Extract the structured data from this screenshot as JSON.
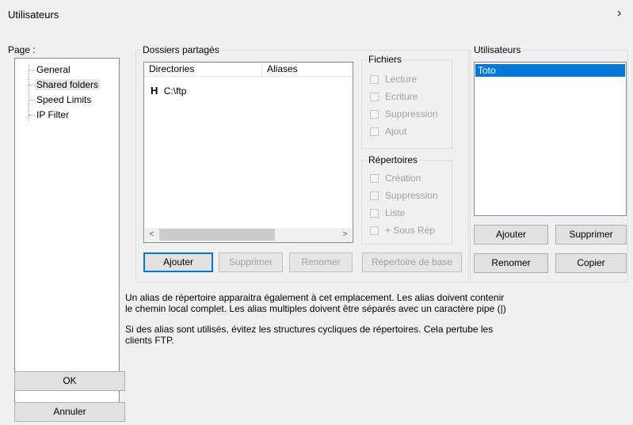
{
  "window": {
    "title": "Utilisateurs",
    "close_glyph": "›"
  },
  "page_panel": {
    "label": "Page :",
    "items": [
      "General",
      "Shared folders",
      "Speed Limits",
      "IP Filter"
    ]
  },
  "shared": {
    "group_title": "Dossiers partagés",
    "columns": [
      "Directories",
      "Aliases"
    ],
    "rows": [
      {
        "flag": "H",
        "directory": "C:\\ftp",
        "alias": ""
      }
    ],
    "scroll_left": "<",
    "scroll_right": ">",
    "buttons": {
      "add": "Ajouter",
      "remove": "Supprimer",
      "rename": "Renomer",
      "base": "Répertoire de base"
    }
  },
  "fichiers": {
    "group_title": "Fichiers",
    "options": [
      "Lecture",
      "Ecriture",
      "Suppression",
      "Ajout"
    ]
  },
  "repertoires": {
    "group_title": "Répertoires",
    "options": [
      "Création",
      "Suppression",
      "Liste",
      "+ Sous Rép"
    ]
  },
  "users": {
    "group_title": "Utilisateurs",
    "list": [
      "Toto"
    ],
    "buttons": {
      "add": "Ajouter",
      "remove": "Supprimer",
      "rename": "Renomer",
      "copy": "Copier"
    }
  },
  "help": {
    "line1": "Un alias de répertoire apparaitra également à cet emplacement. Les alias doivent contenir",
    "line2": "le chemin local complet. Les alias multiples doivent être séparés avec un caractère pipe (|)",
    "line3": "Si des alias sont utilisés, évitez les structures cycliques de répertoires. Cela pertube les",
    "line4": "clients FTP."
  },
  "dialog_buttons": {
    "ok": "OK",
    "cancel": "Annuler"
  },
  "colors": {
    "selection": "#0078d7",
    "background": "#f0f0f0"
  }
}
